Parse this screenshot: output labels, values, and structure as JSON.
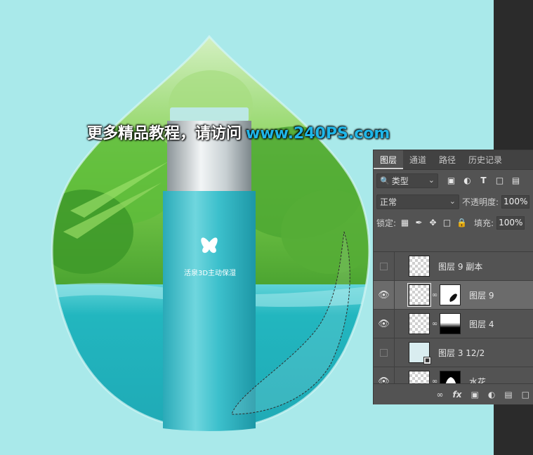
{
  "watermark": {
    "text": "更多精品教程，请访问",
    "url": "www.240PS.com"
  },
  "bottle": {
    "label": "活泉3D主动保湿"
  },
  "panel": {
    "tabs": [
      {
        "label": "图层",
        "active": true
      },
      {
        "label": "通道",
        "active": false
      },
      {
        "label": "路径",
        "active": false
      },
      {
        "label": "历史记录",
        "active": false
      }
    ],
    "filter": {
      "value": "类型",
      "search_icon": "search-icon"
    },
    "blend_mode": "正常",
    "opacity_label": "不透明度:",
    "opacity_value": "100%",
    "lock_label": "锁定:",
    "fill_label": "填充:",
    "fill_value": "100%",
    "layers": [
      {
        "name": "图层 9 副本",
        "visible": false,
        "selected": false,
        "has_mask": false
      },
      {
        "name": "图层 9",
        "visible": true,
        "selected": true,
        "has_mask": true
      },
      {
        "name": "图层 4",
        "visible": true,
        "selected": false,
        "has_mask": true
      },
      {
        "name": "图层 3 12/2",
        "visible": false,
        "selected": false,
        "has_mask": false
      },
      {
        "name": "水花",
        "visible": true,
        "selected": false,
        "has_mask": true
      }
    ],
    "footer_icons": [
      "link-icon",
      "fx-icon",
      "mask-icon",
      "adjustment-icon",
      "folder-icon",
      "new-layer-icon"
    ],
    "fx_label": "fx"
  },
  "colors": {
    "canvas_bg": "#a9e9ea",
    "panel_bg": "#535353",
    "water": "#2cc2c9",
    "url_blue": "#1fb6e8"
  }
}
